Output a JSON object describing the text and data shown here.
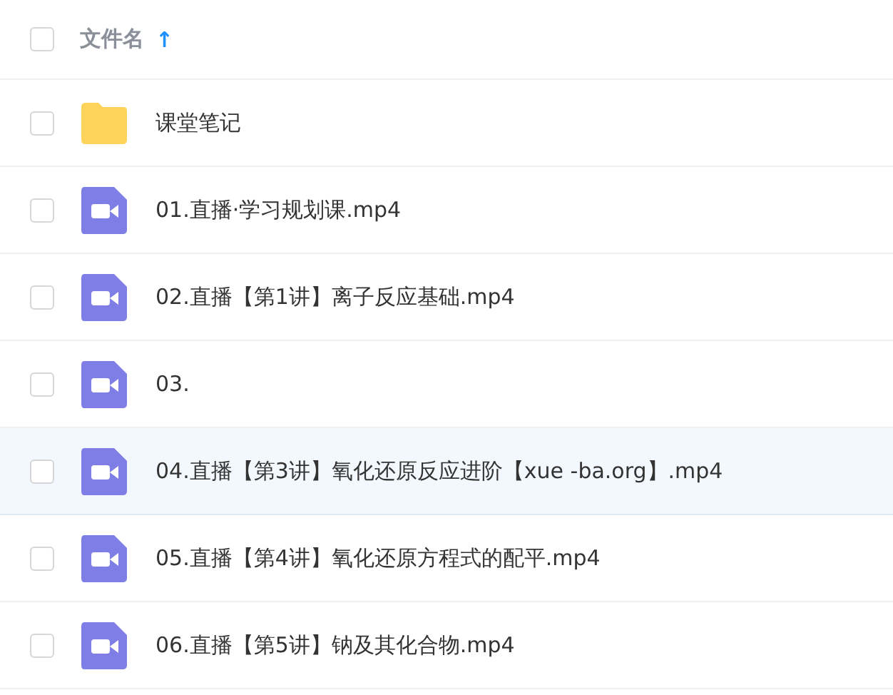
{
  "header": {
    "label": "文件名",
    "sort_arrow": "↑",
    "checked": false
  },
  "files": [
    {
      "kind": "folder",
      "name": "课堂笔记",
      "checked": false,
      "selected": false
    },
    {
      "kind": "video",
      "name": "01.直播·学习规划课.mp4",
      "checked": false,
      "selected": false
    },
    {
      "kind": "video",
      "name": "02.直播【第1讲】离子反应基础.mp4",
      "checked": false,
      "selected": false
    },
    {
      "kind": "video",
      "name": "03.",
      "checked": false,
      "selected": false
    },
    {
      "kind": "video",
      "name": "04.直播【第3讲】氧化还原反应进阶【xue -ba.org】.mp4",
      "checked": false,
      "selected": true
    },
    {
      "kind": "video",
      "name": "05.直播【第4讲】氧化还原方程式的配平.mp4",
      "checked": false,
      "selected": false
    },
    {
      "kind": "video",
      "name": "06.直播【第5讲】钠及其化合物.mp4",
      "checked": false,
      "selected": false
    }
  ]
}
